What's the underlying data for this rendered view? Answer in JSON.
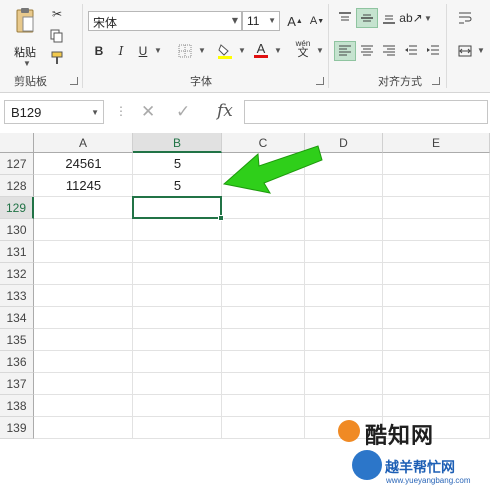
{
  "clipboard": {
    "paste_label": "粘贴",
    "group_label": "剪贴板"
  },
  "font": {
    "name": "宋体",
    "size": "11",
    "bold": "B",
    "italic": "I",
    "underline": "U",
    "phonetic_top": "wén",
    "phonetic_bottom": "文",
    "group_label": "字体"
  },
  "alignment": {
    "group_label": "对齐方式"
  },
  "formula_bar": {
    "name_box": "B129",
    "cancel": "✕",
    "enter": "✓",
    "fx": "fx",
    "value": ""
  },
  "columns": [
    "A",
    "B",
    "C",
    "D",
    "E"
  ],
  "selected_column": "B",
  "rows": [
    {
      "num": "127",
      "a": "24561",
      "b": "5"
    },
    {
      "num": "128",
      "a": "11245",
      "b": "5"
    },
    {
      "num": "129",
      "a": "",
      "b": ""
    },
    {
      "num": "130",
      "a": "",
      "b": ""
    },
    {
      "num": "131",
      "a": "",
      "b": ""
    },
    {
      "num": "132",
      "a": "",
      "b": ""
    },
    {
      "num": "133",
      "a": "",
      "b": ""
    },
    {
      "num": "134",
      "a": "",
      "b": ""
    },
    {
      "num": "135",
      "a": "",
      "b": ""
    },
    {
      "num": "136",
      "a": "",
      "b": ""
    },
    {
      "num": "137",
      "a": "",
      "b": ""
    },
    {
      "num": "138",
      "a": "",
      "b": ""
    },
    {
      "num": "139",
      "a": "",
      "b": ""
    }
  ],
  "selected_row": "129",
  "accent_color": "#217346",
  "annotation_arrow_color": "#2fcf1a",
  "watermark": {
    "brand": "酷知网",
    "sub": "越羊帮忙网",
    "url": "www.yueyangbang.com"
  }
}
